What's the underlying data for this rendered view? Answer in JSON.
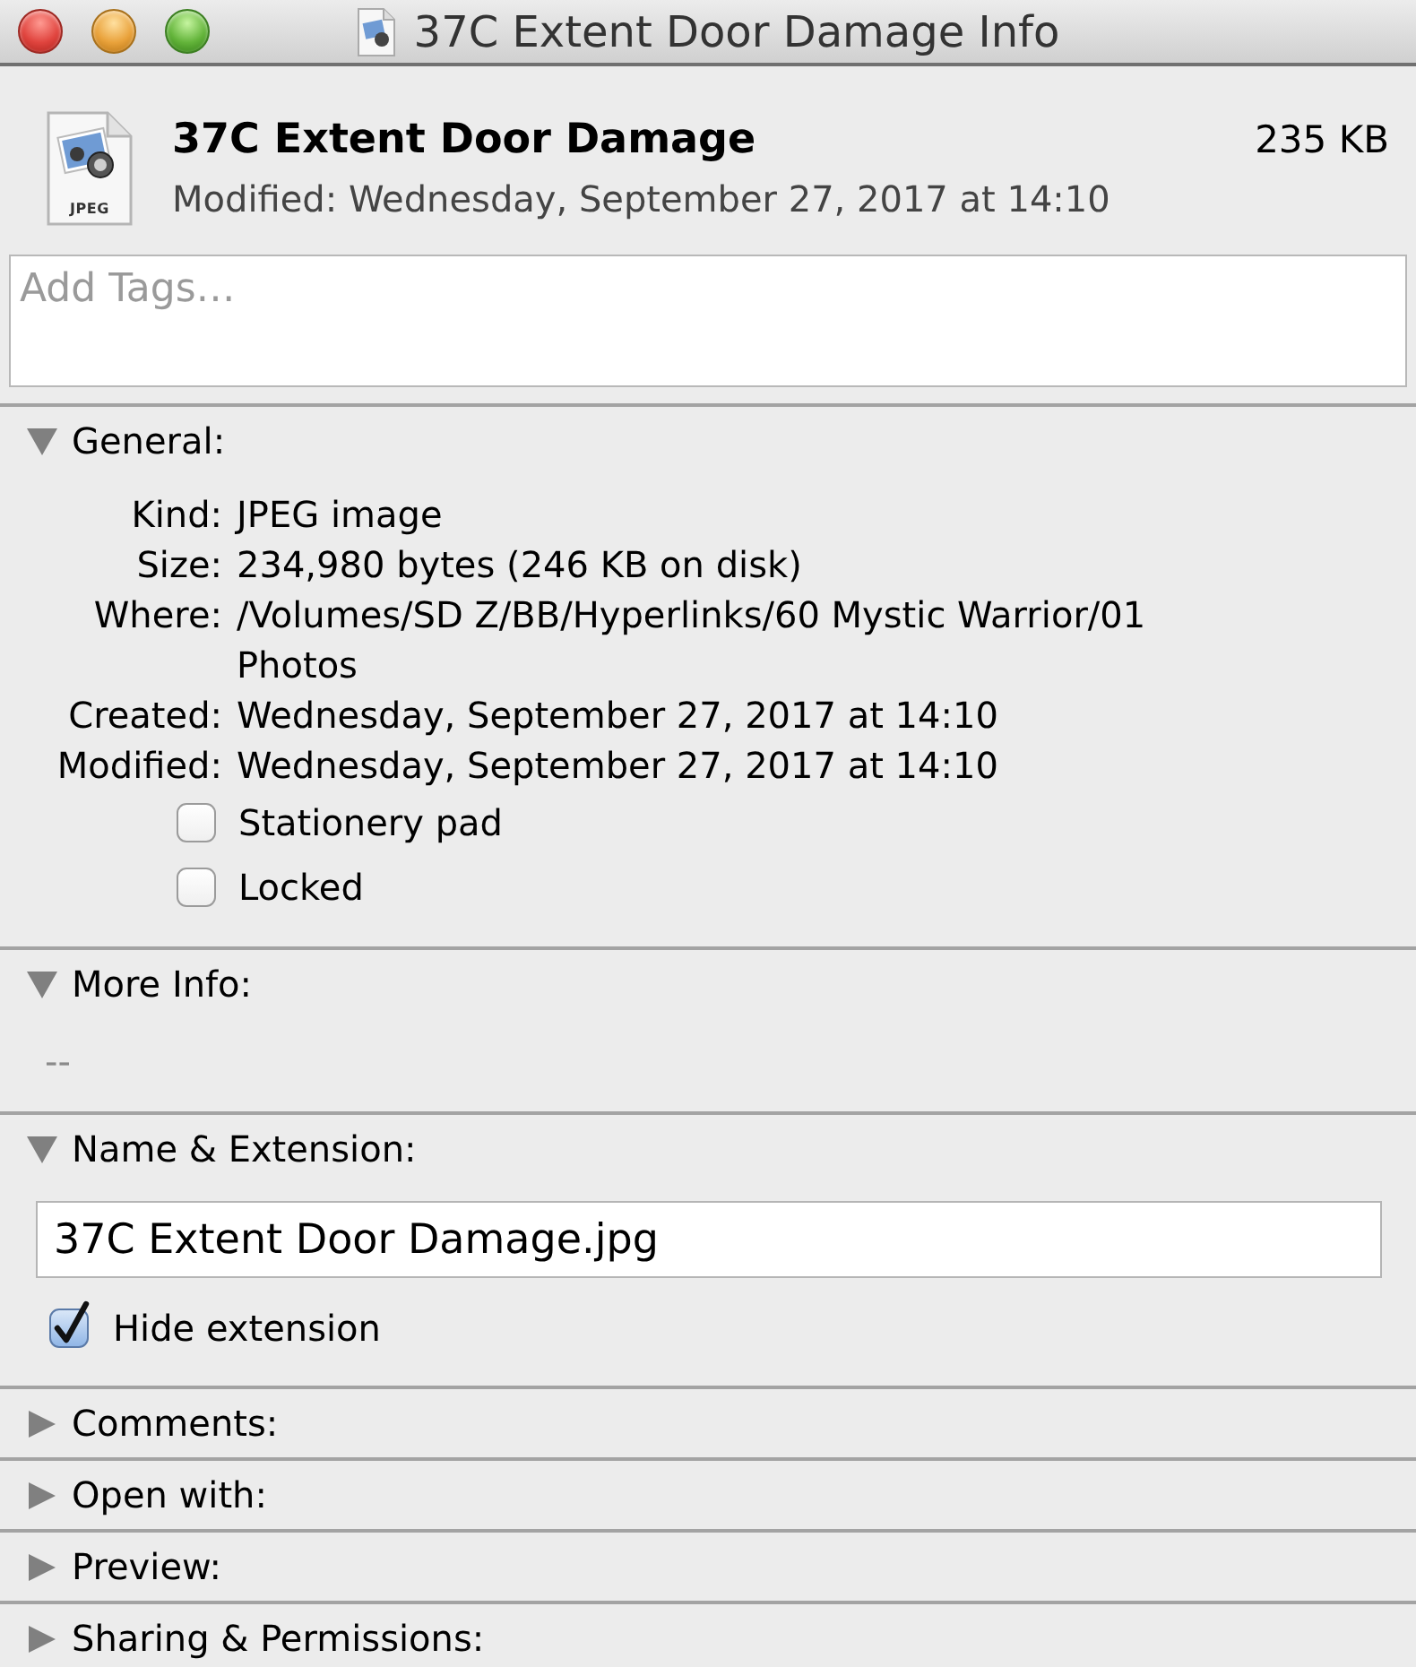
{
  "window": {
    "title": "37C Extent Door Damage Info"
  },
  "header": {
    "name": "37C Extent Door Damage",
    "size": "235 KB",
    "modified": "Modified: Wednesday, September 27, 2017 at 14:10",
    "icon_label": "JPEG"
  },
  "tags": {
    "placeholder": "Add Tags…"
  },
  "sections": [
    {
      "kind": "general",
      "title": "General:",
      "expanded": true,
      "rows": [
        {
          "label": "Kind:",
          "value": "JPEG image"
        },
        {
          "label": "Size:",
          "value": "234,980 bytes (246 KB on disk)"
        },
        {
          "label": "Where:",
          "value": "/Volumes/SD Z/BB/Hyperlinks/60 Mystic Warrior/01 Photos"
        },
        {
          "label": "Created:",
          "value": "Wednesday, September 27, 2017 at 14:10"
        },
        {
          "label": "Modified:",
          "value": "Wednesday, September 27, 2017 at 14:10"
        }
      ],
      "checkboxes": [
        {
          "label": "Stationery pad",
          "checked": false
        },
        {
          "label": "Locked",
          "checked": false
        }
      ]
    },
    {
      "kind": "more_info",
      "title": "More Info:",
      "expanded": true,
      "text": "--"
    },
    {
      "kind": "name",
      "title": "Name & Extension:",
      "expanded": true,
      "value": "37C Extent Door Damage.jpg",
      "checkboxes": [
        {
          "label": "Hide extension",
          "checked": true
        }
      ]
    },
    {
      "kind": "comments",
      "title": "Comments:",
      "expanded": false
    },
    {
      "kind": "open_with",
      "title": "Open with:",
      "expanded": false
    },
    {
      "kind": "preview",
      "title": "Preview:",
      "expanded": false
    },
    {
      "kind": "sharing",
      "title": "Sharing & Permissions:",
      "expanded": false
    }
  ]
}
